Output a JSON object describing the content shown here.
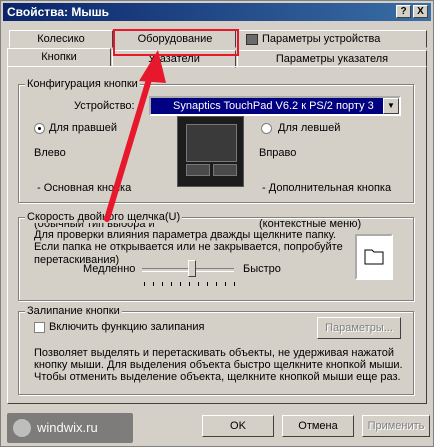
{
  "window": {
    "title": "Свойства: Мышь",
    "help_btn": "?",
    "close_btn": "X"
  },
  "tabs_back": [
    {
      "label": "Колесико"
    },
    {
      "label": "Оборудование"
    },
    {
      "label": "Параметры устройства"
    }
  ],
  "tabs_front": [
    {
      "label": "Кнопки"
    },
    {
      "label": "Указатели"
    },
    {
      "label": "Параметры указателя"
    }
  ],
  "button_config": {
    "legend": "Конфигурация кнопки",
    "device_label": "Устройство:",
    "device_value": "Synaptics TouchPad V6.2 к PS/2 порту 3",
    "right_handed": "Для правшей",
    "left_handed": "Для левшей",
    "left_title": "Влево",
    "left_desc": [
      " - Основная кнопка",
      "(обычный тип выбора и",
      "перетаскивания)"
    ],
    "right_title": "Вправо",
    "right_desc": [
      " - Дополнительная кнопка",
      "(контекстные меню)"
    ]
  },
  "double_click": {
    "legend": "Скорость двойного щелчка(U)",
    "desc": [
      "Для проверки влияния параметра дважды щелкните папку.",
      "Если папка не открывается или не закрывается, попробуйте"
    ],
    "slow": "Медленно",
    "fast": "Быстро",
    "speed": 0.5
  },
  "click_lock": {
    "legend": "Залипание кнопки",
    "checkbox": "Включить функцию залипания",
    "checked": false,
    "params_btn": "Параметры...",
    "desc": [
      "Позволяет выделять и перетаскивать объекты, не удерживая нажатой",
      "кнопку мыши. Для выделения объекта быстро щелкните кнопкой мыши.",
      "Чтобы отменить выделение объекта, щелкните кнопкой мыши еще раз."
    ]
  },
  "footer": {
    "ok": "OK",
    "cancel": "Отмена",
    "apply": "Применить"
  },
  "watermark": "windwix.ru",
  "colors": {
    "highlight": "#e8182c",
    "title_bar": "#0a246a",
    "selection": "#000080"
  }
}
